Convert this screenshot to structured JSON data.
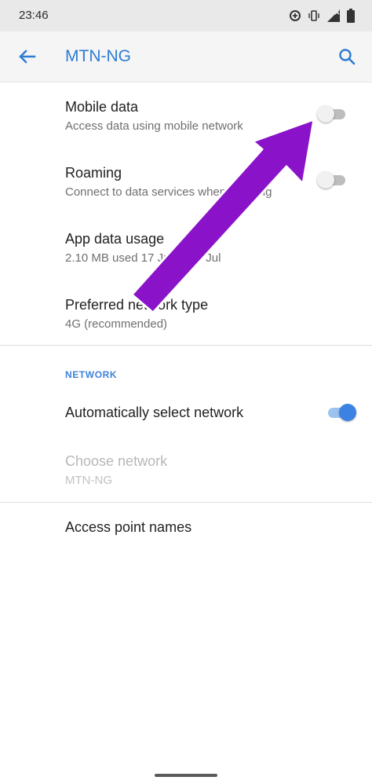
{
  "status_bar": {
    "time": "23:46",
    "icons": [
      "data-saver-icon",
      "vibrate-icon",
      "signal-icon",
      "battery-icon"
    ]
  },
  "app_bar": {
    "title": "MTN-NG",
    "back_icon": "arrow-back-icon",
    "search_icon": "search-icon",
    "accent_color": "#2e7bd3"
  },
  "settings": {
    "mobile_data": {
      "title": "Mobile data",
      "summary": "Access data using mobile network",
      "enabled": false
    },
    "roaming": {
      "title": "Roaming",
      "summary": "Connect to data services when roaming",
      "enabled": false
    },
    "app_data_usage": {
      "title": "App data usage",
      "summary": "2.10 MB used 17 Jun – 16 Jul"
    },
    "preferred_network": {
      "title": "Preferred network type",
      "summary": "4G (recommended)"
    }
  },
  "network_section": {
    "header": "NETWORK",
    "auto_select": {
      "title": "Automatically select network",
      "enabled": true
    },
    "choose_network": {
      "title": "Choose network",
      "summary": "MTN-NG",
      "disabled": true
    }
  },
  "access_point_names": {
    "title": "Access point names"
  },
  "annotation": {
    "arrow_color": "#8a12c8"
  }
}
